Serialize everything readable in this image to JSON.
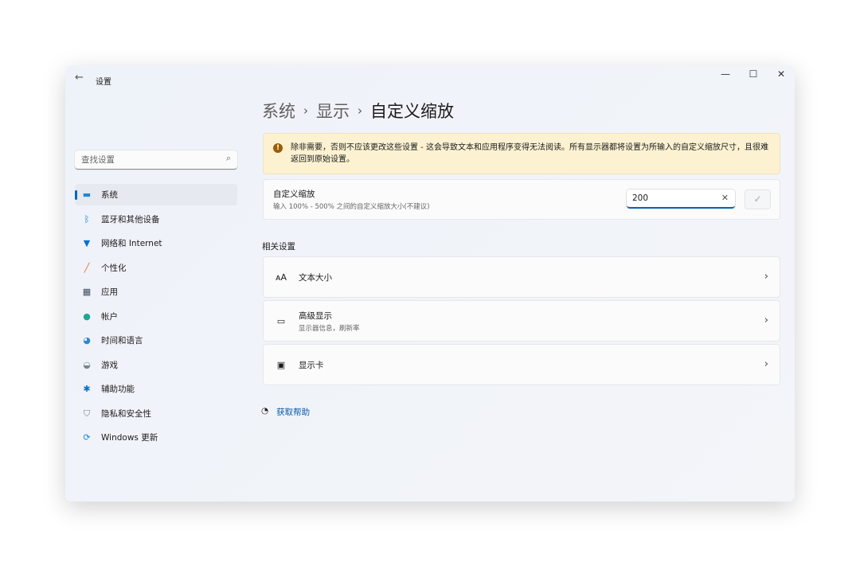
{
  "window": {
    "title": "设置",
    "back_icon": "back-arrow-icon"
  },
  "search": {
    "placeholder": "查找设置"
  },
  "nav": [
    {
      "label": "系统",
      "icon": "system-icon",
      "selected": true
    },
    {
      "label": "蓝牙和其他设备",
      "icon": "bluetooth-icon"
    },
    {
      "label": "网络和 Internet",
      "icon": "wifi-icon"
    },
    {
      "label": "个性化",
      "icon": "brush-icon"
    },
    {
      "label": "应用",
      "icon": "apps-icon"
    },
    {
      "label": "帐户",
      "icon": "account-icon"
    },
    {
      "label": "时间和语言",
      "icon": "globe-clock-icon"
    },
    {
      "label": "游戏",
      "icon": "gamepad-icon"
    },
    {
      "label": "辅助功能",
      "icon": "accessibility-icon"
    },
    {
      "label": "隐私和安全性",
      "icon": "shield-icon"
    },
    {
      "label": "Windows 更新",
      "icon": "update-icon"
    }
  ],
  "breadcrumb": [
    "系统",
    "显示",
    "自定义缩放"
  ],
  "warning": "除非需要，否则不应该更改这些设置 - 这会导致文本和应用程序变得无法阅读。所有显示器都将设置为所输入的自定义缩放尺寸，且很难返回到原始设置。",
  "custom_scale": {
    "title": "自定义缩放",
    "desc": "输入 100% - 500% 之间的自定义缩放大小(不建议)",
    "value": "200"
  },
  "related": {
    "heading": "相关设置",
    "items": [
      {
        "title": "文本大小",
        "desc": ""
      },
      {
        "title": "高级显示",
        "desc": "显示器信息，刷新率"
      },
      {
        "title": "显示卡",
        "desc": ""
      }
    ]
  },
  "help": "获取帮助",
  "colors": {
    "accent": "#0067c0",
    "warning_bg": "#fcf2d2"
  }
}
